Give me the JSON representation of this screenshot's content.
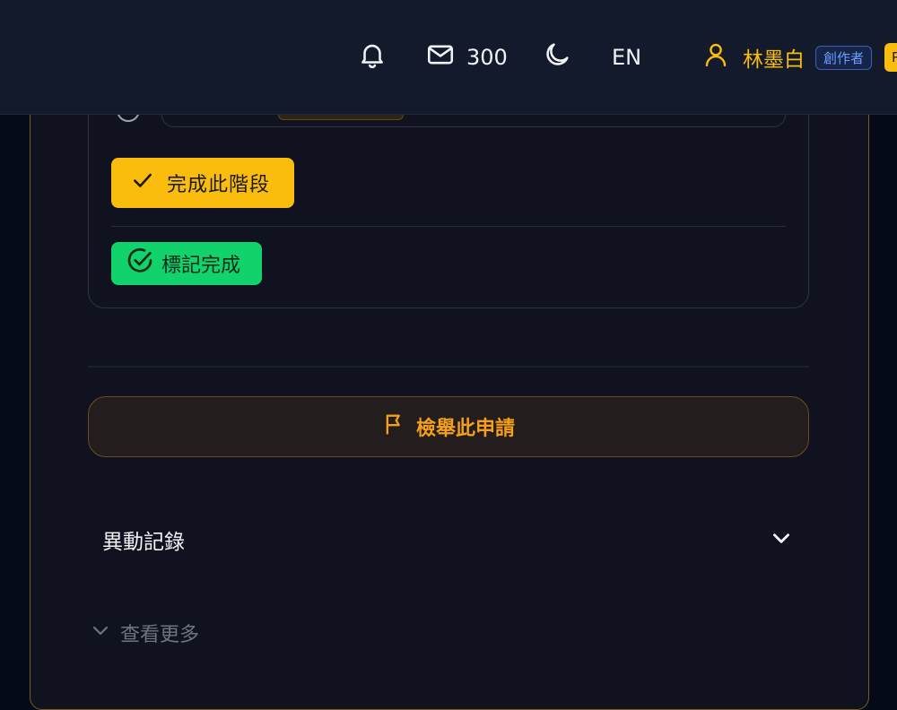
{
  "header": {
    "coins": "300",
    "language": "EN",
    "user_name": "林墨白",
    "role_badge": "創作者",
    "extra_badge": "P"
  },
  "stage": {
    "complete_button_label": "完成此階段",
    "done_badge_label": "標記完成"
  },
  "report_button_label": "檢舉此申請",
  "history": {
    "title": "異動記錄"
  },
  "see_more_label": "查看更多",
  "colors": {
    "accent": "#fbbd0d",
    "success": "#12d36b",
    "warning": "#f59f1a",
    "background": "#10131f"
  }
}
